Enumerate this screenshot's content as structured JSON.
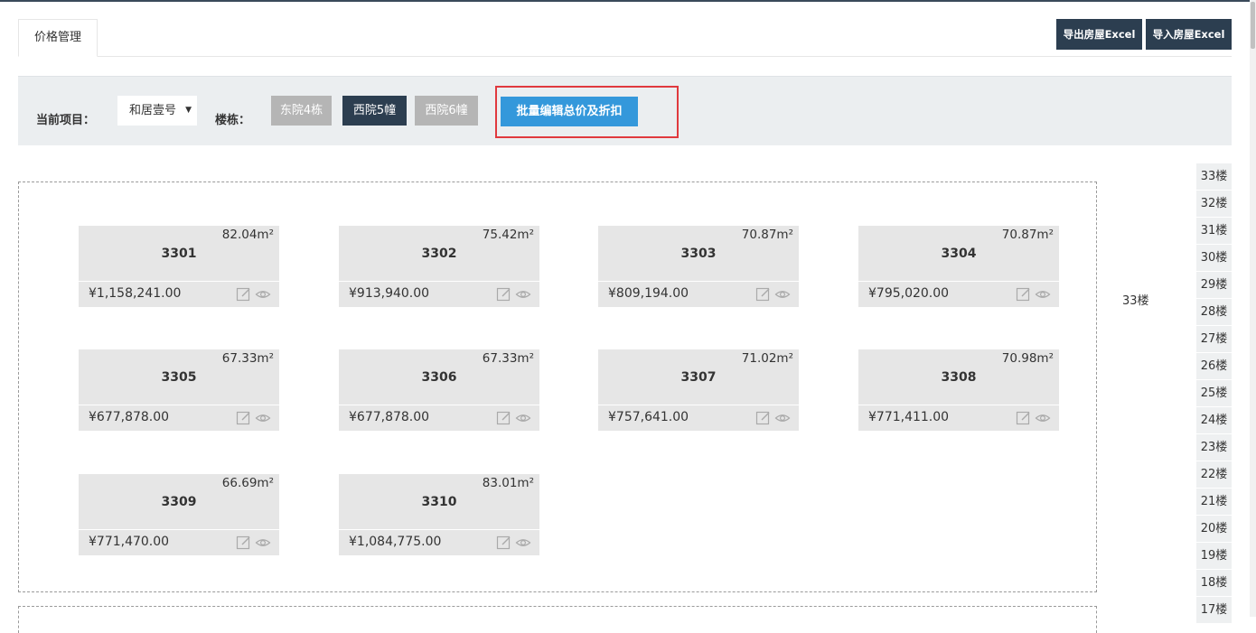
{
  "header": {
    "tab_label": "价格管理",
    "export_label": "导出房屋Excel",
    "import_label": "导入房屋Excel"
  },
  "filter": {
    "project_label": "当前项目：",
    "project_value": "和居壹号",
    "building_label": "楼栋：",
    "buildings": [
      {
        "label": "东院4栋",
        "active": false
      },
      {
        "label": "西院5幢",
        "active": true
      },
      {
        "label": "西院6幢",
        "active": false
      }
    ],
    "batch_edit_label": "批量编辑总价及折扣"
  },
  "floor": {
    "label": "33楼",
    "rooms": [
      {
        "room": "3301",
        "area": "82.04m²",
        "price": "¥1,158,241.00"
      },
      {
        "room": "3302",
        "area": "75.42m²",
        "price": "¥913,940.00"
      },
      {
        "room": "3303",
        "area": "70.87m²",
        "price": "¥809,194.00"
      },
      {
        "room": "3304",
        "area": "70.87m²",
        "price": "¥795,020.00"
      },
      {
        "room": "3305",
        "area": "67.33m²",
        "price": "¥677,878.00"
      },
      {
        "room": "3306",
        "area": "67.33m²",
        "price": "¥677,878.00"
      },
      {
        "room": "3307",
        "area": "71.02m²",
        "price": "¥757,641.00"
      },
      {
        "room": "3308",
        "area": "70.98m²",
        "price": "¥771,411.00"
      },
      {
        "room": "3309",
        "area": "66.69m²",
        "price": "¥771,470.00"
      },
      {
        "room": "3310",
        "area": "83.01m²",
        "price": "¥1,084,775.00"
      }
    ]
  },
  "floor_nav": [
    "33楼",
    "32楼",
    "31楼",
    "30楼",
    "29楼",
    "28楼",
    "27楼",
    "26楼",
    "25楼",
    "24楼",
    "23楼",
    "22楼",
    "21楼",
    "20楼",
    "19楼",
    "18楼",
    "17楼"
  ],
  "colors": {
    "dark": "#2c3e50",
    "accent": "#3498db",
    "highlight_box": "#e0393e",
    "inactive_button": "#b5b5b5",
    "card_bg": "#e6e6e6"
  }
}
